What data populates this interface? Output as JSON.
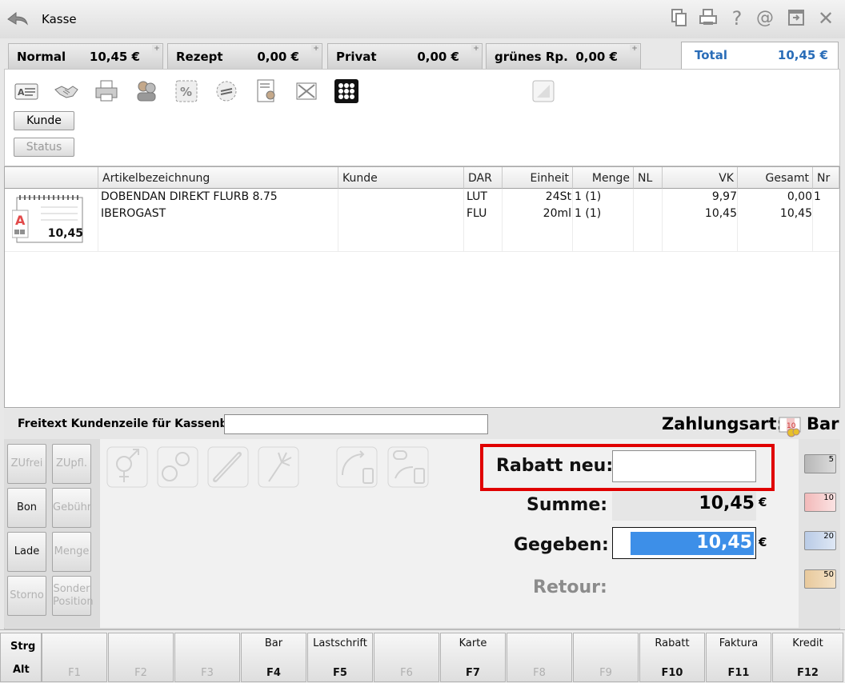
{
  "app": {
    "title": "Kasse"
  },
  "tabs": [
    {
      "label": "Normal",
      "value": "10,45 €"
    },
    {
      "label": "Rezept",
      "value": "0,00 €"
    },
    {
      "label": "Privat",
      "value": "0,00 €"
    },
    {
      "label": "grünes Rp.",
      "value": "0,00 €"
    }
  ],
  "total": {
    "label": "Total",
    "value": "10,45 €"
  },
  "toolbar": {
    "kunde_label": "Kunde",
    "status_label": "Status"
  },
  "table": {
    "columns": [
      "Artikelbezeichnung",
      "Kunde",
      "DAR",
      "Einheit",
      "Menge",
      "NL",
      "VK",
      "Gesamt",
      "Nr"
    ],
    "receipt_amount": "10,45",
    "rows": [
      {
        "name": "DOBENDAN DIREKT FLURB 8.75",
        "kunde": "",
        "dar": "LUT",
        "einheit": "24St",
        "menge": "1 (1)",
        "nl": "",
        "vk": "9,97",
        "gesamt": "0,00",
        "nr": "1"
      },
      {
        "name": "IBEROGAST",
        "kunde": "",
        "dar": "FLU",
        "einheit": "20ml",
        "menge": "1 (1)",
        "nl": "",
        "vk": "10,45",
        "gesamt": "10,45",
        "nr": ""
      }
    ]
  },
  "freitext": {
    "label": "Freitext Kundenzeile für Kassenbon:",
    "value": ""
  },
  "payment": {
    "label": "Zahlungsart:",
    "method": "Bar"
  },
  "side_buttons": [
    {
      "label": "ZUfrei",
      "enabled": false
    },
    {
      "label": "ZUpfl.",
      "enabled": false
    },
    {
      "label": "Bon",
      "enabled": true
    },
    {
      "label": "Gebühr",
      "enabled": false
    },
    {
      "label": "Lade",
      "enabled": true
    },
    {
      "label": "Menge",
      "enabled": false
    },
    {
      "label": "Storno",
      "enabled": false
    },
    {
      "label": "Sonder Position",
      "enabled": false
    }
  ],
  "checkout": {
    "rabatt_label": "Rabatt neu:",
    "rabatt_value": "",
    "summe_label": "Summe:",
    "summe_value": "10,45",
    "gegeben_label": "Gegeben:",
    "gegeben_value": "10,45",
    "retour_label": "Retour:",
    "currency": "€"
  },
  "bills": [
    "5",
    "10",
    "20",
    "50"
  ],
  "modifiers": {
    "strg": "Strg",
    "alt": "Alt"
  },
  "fkeys": [
    {
      "key": "F1",
      "label": ""
    },
    {
      "key": "F2",
      "label": ""
    },
    {
      "key": "F3",
      "label": ""
    },
    {
      "key": "F4",
      "label": "Bar"
    },
    {
      "key": "F5",
      "label": "Lastschrift"
    },
    {
      "key": "F6",
      "label": ""
    },
    {
      "key": "F7",
      "label": "Karte"
    },
    {
      "key": "F8",
      "label": ""
    },
    {
      "key": "F9",
      "label": ""
    },
    {
      "key": "F10",
      "label": "Rabatt"
    },
    {
      "key": "F11",
      "label": "Faktura"
    },
    {
      "key": "F12",
      "label": "Kredit"
    }
  ],
  "colors": {
    "accent": "#2a6db8",
    "highlight": "#3d8fe8",
    "rabatt_border": "#e00000"
  }
}
